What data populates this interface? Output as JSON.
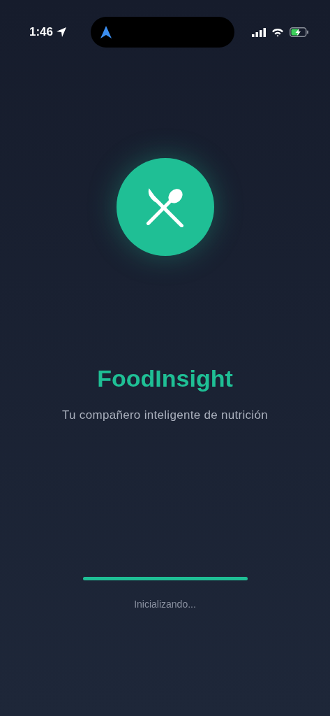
{
  "status_bar": {
    "time": "1:46"
  },
  "app": {
    "name": "FoodInsight",
    "tagline": "Tu compañero inteligente de nutrición"
  },
  "loading": {
    "level": 1,
    "message": "Inicializando..."
  }
}
